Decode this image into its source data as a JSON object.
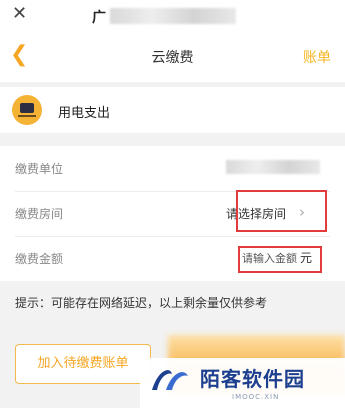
{
  "topbar": {
    "close_icon": "close-icon",
    "title_fragment": "广"
  },
  "navbar": {
    "back_icon": "chevron-left-icon",
    "title": "云缴费",
    "right_label": "账单",
    "accent_color": "#f5a623"
  },
  "expense": {
    "label": "用电支出",
    "icon": "tv-monitor-icon"
  },
  "form": {
    "unit_label": "缴费单位",
    "room_label": "缴费房间",
    "room_value": "请选择房间",
    "room_chevron": "chevron-right-icon",
    "amount_label": "缴费金额",
    "amount_placeholder": "请输入金额",
    "amount_unit": "元"
  },
  "tip": "提示：可能存在网络延迟，以上剩余量仅供参考",
  "buttons": {
    "add_to_bill": "加入待缴费账单"
  },
  "watermark": {
    "text": "陌客软件园",
    "sub": "IMOOC.XIN",
    "color": "#1d3f8f"
  },
  "highlight_color": "#e23b3b"
}
